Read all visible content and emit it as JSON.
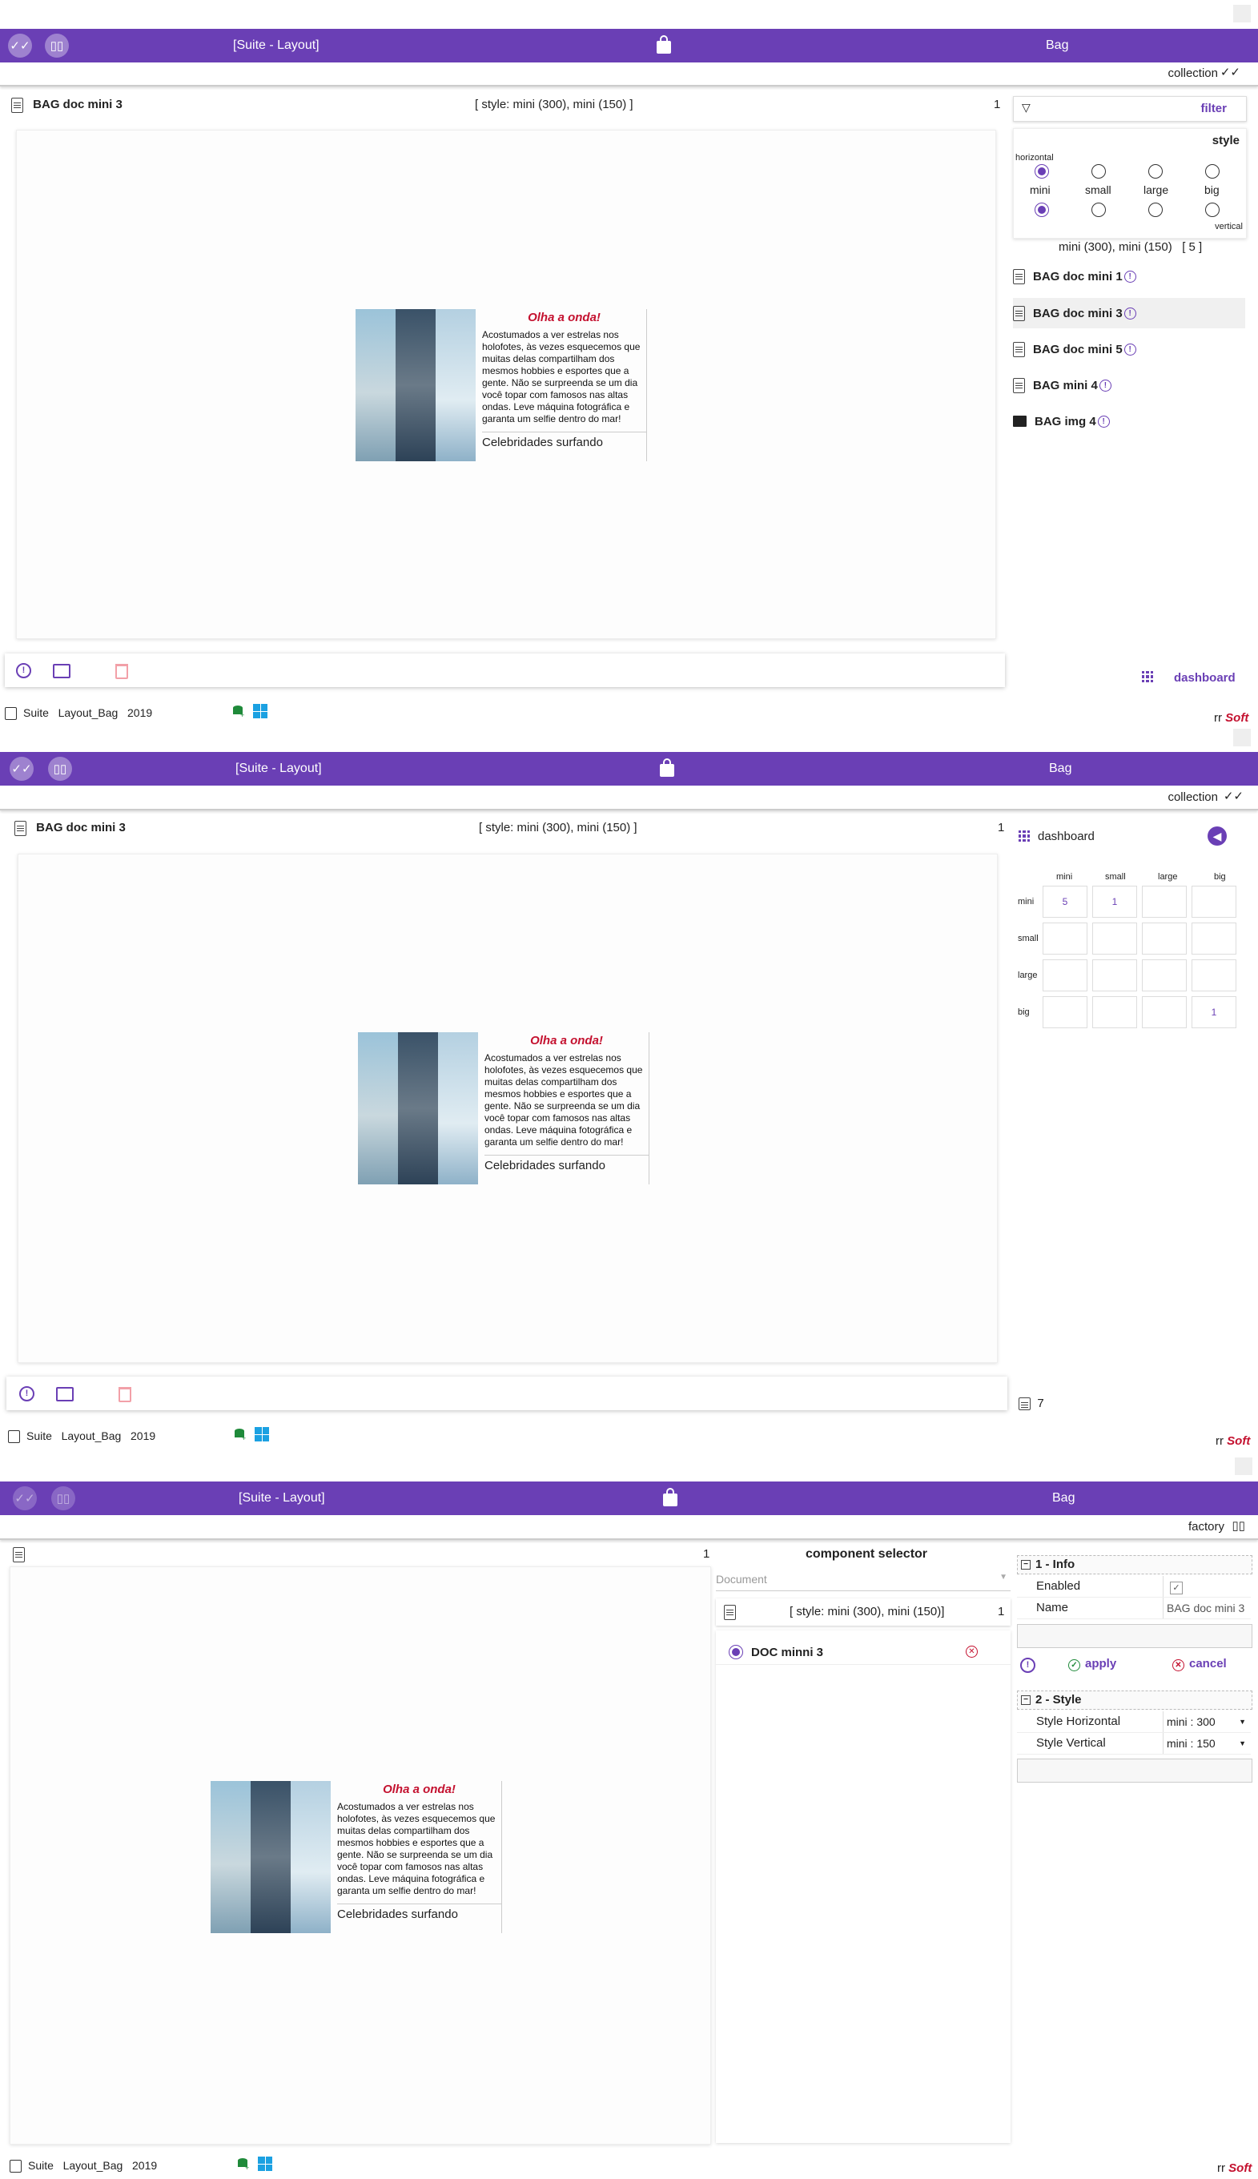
{
  "header": {
    "title": "[Suite - Layout]",
    "right_title": "Bag",
    "buttons": [
      "check-all",
      "bag-pair"
    ]
  },
  "colors": {
    "accent": "#6a3fb5",
    "danger": "#c4112f",
    "win": "#1ba1e2"
  },
  "card": {
    "title": "Olha a onda!",
    "body": "Acostumados a ver estrelas nos holofotes, às vezes esquecemos que muitas delas compartilham dos mesmos hobbies e esportes que a gente. Não se surpreenda se um dia você topar com famosos nas altas ondas. Leve máquina fotográfica  e garanta um selfie dentro do mar!",
    "caption": "Celebridades surfando"
  },
  "footer": {
    "suite": "Suite",
    "layout": "Layout_Bag",
    "year": "2019",
    "brand_rr": "rr",
    "brand_soft": "Soft"
  },
  "panel1": {
    "collection_label": "collection",
    "doc_title": "BAG doc mini 3",
    "style_text": "[ style: mini (300), mini (150) ]",
    "page_num": "1",
    "filter_label": "filter",
    "style_label": "style",
    "horizontal_label": "horizontal",
    "vertical_label": "vertical",
    "size_options": [
      "mini",
      "small",
      "large",
      "big"
    ],
    "horizontal_selected": "mini",
    "vertical_selected": "mini",
    "summary": "mini (300), mini (150)   [ 5 ]",
    "items": [
      {
        "label": "BAG doc mini 1",
        "icon": "doc-icon"
      },
      {
        "label": "BAG doc mini 3",
        "icon": "doc-icon"
      },
      {
        "label": "BAG doc mini 5",
        "icon": "doc-icon"
      },
      {
        "label": "BAG mini 4",
        "icon": "doc-icon"
      },
      {
        "label": "BAG img 4",
        "icon": "image-icon"
      }
    ],
    "dashboard_label": "dashboard"
  },
  "panel2": {
    "collection_label": "collection",
    "doc_title": "BAG doc mini 3",
    "style_text": "[ style: mini (300), mini (150) ]",
    "page_num": "1",
    "dashboard_label": "dashboard",
    "cols": [
      "mini",
      "small",
      "large",
      "big"
    ],
    "rows": [
      "mini",
      "small",
      "large",
      "big"
    ],
    "cells": [
      [
        "5",
        "1",
        "",
        ""
      ],
      [
        "",
        "",
        "",
        ""
      ],
      [
        "",
        "",
        "",
        ""
      ],
      [
        "",
        "",
        "",
        "1"
      ]
    ],
    "bag_count": "7"
  },
  "panel3": {
    "factory_label": "factory",
    "page_num": "1",
    "selector_title": "component selector",
    "selector_placeholder": "Document",
    "selector_style_text": "[ style: mini (300), mini (150)]",
    "selector_num": "1",
    "selected_component": "DOC minni 3",
    "info_section": "1 - Info",
    "enabled_label": "Enabled",
    "name_label": "Name",
    "name_value": "BAG doc mini 3",
    "apply_label": "apply",
    "cancel_label": "cancel",
    "style_section": "2 - Style",
    "style_h_label": "Style Horizontal",
    "style_h_value": "mini : 300",
    "style_v_label": "Style Vertical",
    "style_v_value": "mini : 150"
  }
}
